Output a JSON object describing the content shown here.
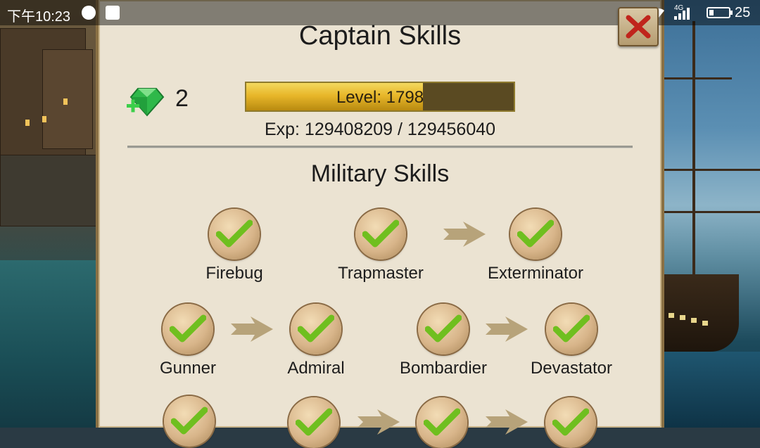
{
  "status_bar": {
    "time": "下午10:23",
    "network": "4G",
    "battery": "25"
  },
  "header": {
    "title": "Captain Skills"
  },
  "currency": {
    "gems": "2"
  },
  "level": {
    "label": "Level: 1798",
    "progress_fraction": 0.66
  },
  "experience": {
    "label": "Exp: 129408209 / 129456040"
  },
  "section": {
    "title": "Military Skills"
  },
  "skills": {
    "row1": [
      "Firebug",
      "Trapmaster",
      "Exterminator"
    ],
    "row2": [
      "Gunner",
      "Admiral",
      "Bombardier",
      "Devastator"
    ]
  },
  "colors": {
    "panel_bg": "#ebe3d2",
    "check_green": "#6fbf1f",
    "close_red": "#c0241c",
    "level_gold": "#e8b72a"
  }
}
